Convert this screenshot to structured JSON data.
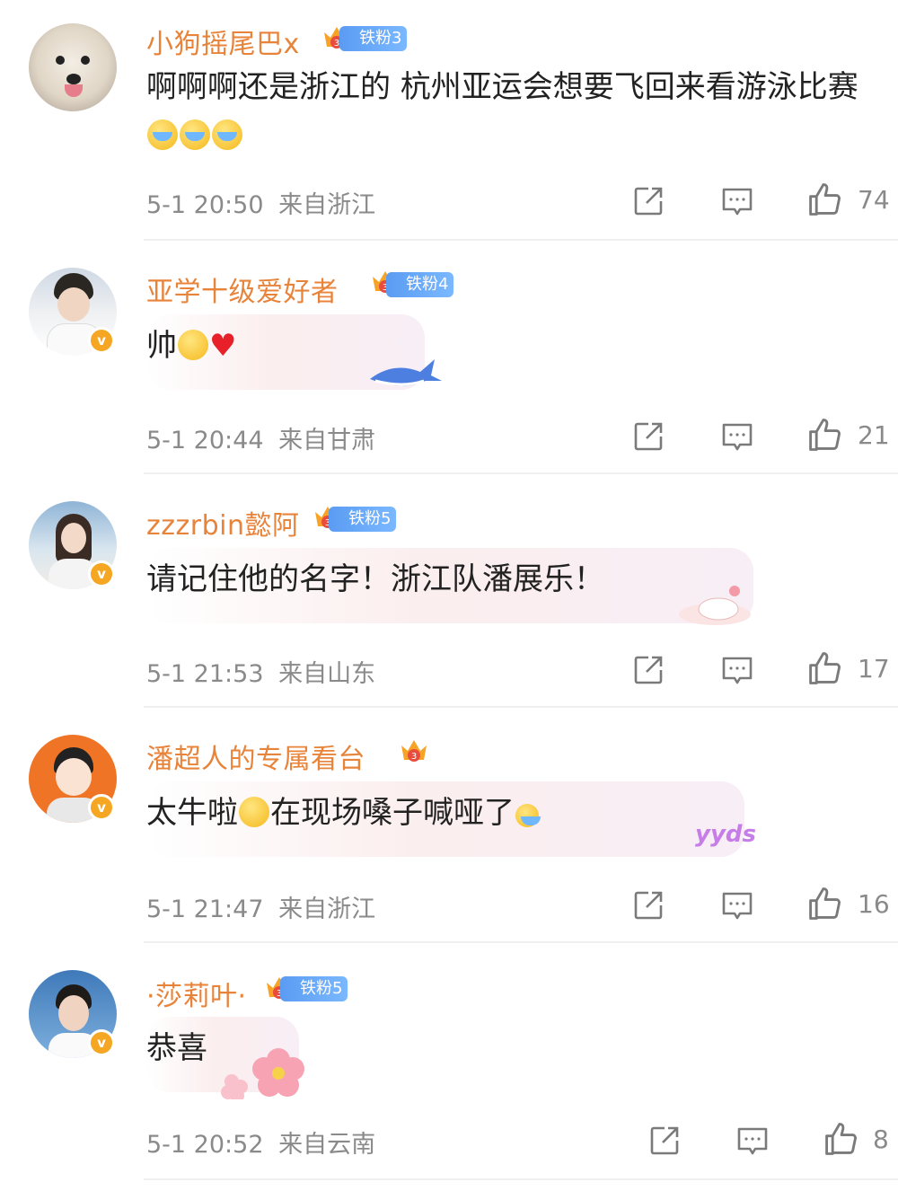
{
  "comments": [
    {
      "username": "小狗摇尾巴x",
      "fan_badge": "铁粉3",
      "text": "啊啊啊还是浙江的 杭州亚运会想要飞回来看游泳比赛",
      "time": "5-1 20:50",
      "location": "来自浙江",
      "likes": "74"
    },
    {
      "username": "亚学十级爱好者",
      "fan_badge": "铁粉4",
      "text": "帅",
      "time": "5-1 20:44",
      "location": "来自甘肃",
      "likes": "21"
    },
    {
      "username": "zzzrbin懿阿",
      "fan_badge": "铁粉5",
      "text": "请记住他的名字！浙江队潘展乐！",
      "time": "5-1 21:53",
      "location": "来自山东",
      "likes": "17"
    },
    {
      "username": "潘超人的专属看台",
      "text_a": "太牛啦",
      "text_b": "在现场嗓子喊哑了",
      "time": "5-1 21:47",
      "location": "来自浙江",
      "likes": "16"
    },
    {
      "username": "·莎莉叶·",
      "fan_badge": "铁粉5",
      "text": "恭喜",
      "time": "5-1 20:52",
      "location": "来自云南",
      "likes": "8"
    }
  ],
  "verified_mark": "v",
  "bubble_sticker_text": "yyds",
  "colors": {
    "username": "#e8833a",
    "meta": "#8a8a8a",
    "fan_badge": "#5b9cf3",
    "verified": "#f5a623"
  }
}
